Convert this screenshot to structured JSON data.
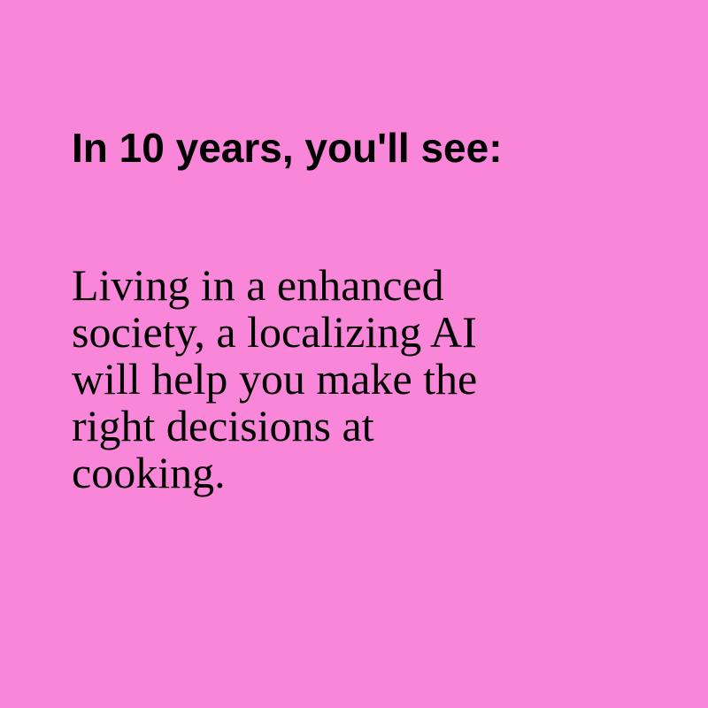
{
  "background_color": "#f986d8",
  "title": "In 10 years, you'll see:",
  "body_lines": [
    "Living in a enhanced",
    "society, a localizing AI",
    "will help you make the",
    "right decisions at",
    "cooking."
  ]
}
